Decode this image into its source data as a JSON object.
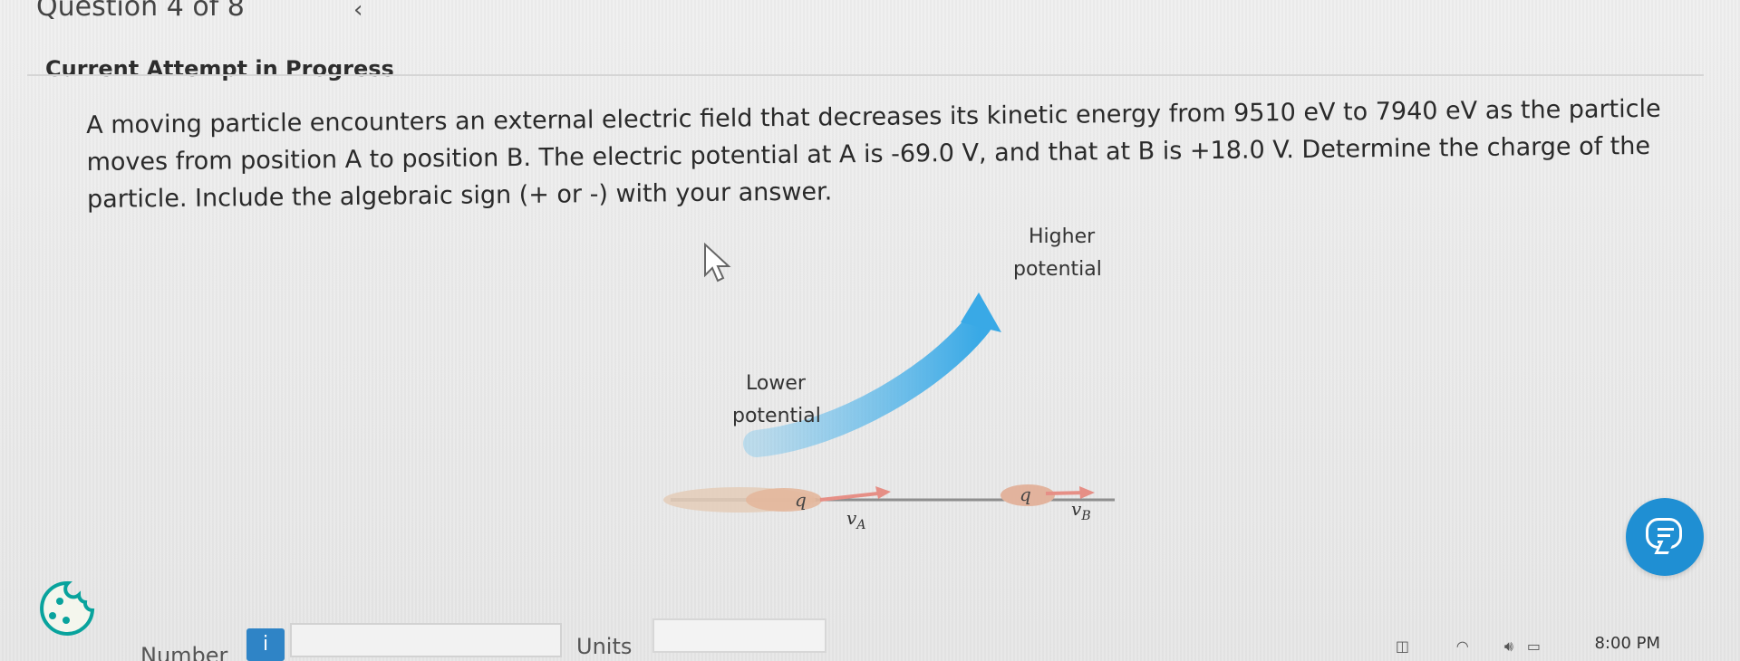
{
  "header": {
    "question_counter": "Question 4 of 8",
    "status": "Current Attempt in Progress"
  },
  "question": {
    "text": "A moving particle encounters an external electric field that decreases its kinetic energy from 9510 eV to 7940 eV as the particle moves from position A to position B. The electric potential at A is -69.0 V, and that at B is +18.0 V. Determine the charge of the particle. Include the algebraic sign (+ or -) with your answer."
  },
  "figure": {
    "higher_label_1": "Higher",
    "higher_label_2": "potential",
    "lower_label_1": "Lower",
    "lower_label_2": "potential",
    "charge_a": "q",
    "charge_b": "q",
    "velocity_a": "vA",
    "velocity_b": "vB",
    "arrow_color": "#39a9e6"
  },
  "inputs": {
    "number_label": "Number",
    "units_label": "Units",
    "info_button": "i",
    "number_value": "",
    "units_value": ""
  },
  "taskbar": {
    "time": "8:00 PM"
  },
  "icons": {
    "cursor": "cursor-icon",
    "chat": "chat-icon",
    "cookie": "cookie-icon",
    "chevron": "chevron-left-icon"
  }
}
